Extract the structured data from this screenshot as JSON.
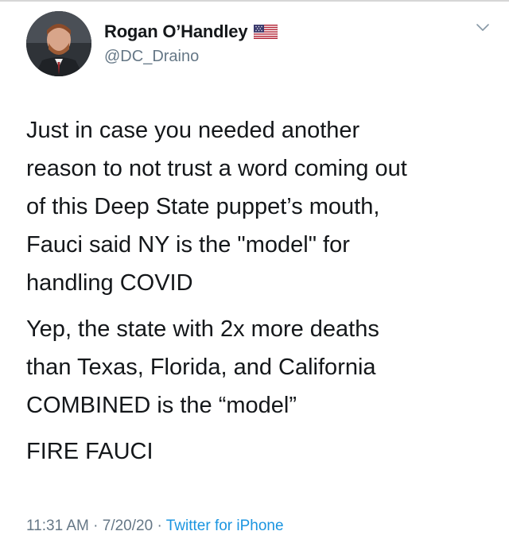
{
  "tweet": {
    "author": {
      "display_name": "Rogan O’Handley",
      "flag_icon": "us-flag-icon",
      "handle": "@DC_Draino"
    },
    "menu_icon": "chevron-down-icon",
    "paragraphs": [
      "Just in case you needed another\nreason to not trust a word coming out\nof this Deep State puppet’s mouth,\nFauci said NY is the \"model\" for\nhandling COVID",
      "Yep, the state with 2x more deaths\nthan Texas, Florida, and California\nCOMBINED is the “model”",
      "FIRE FAUCI"
    ],
    "meta": {
      "time": "11:31 AM",
      "separator": " · ",
      "date": "7/20/20",
      "source": "Twitter for iPhone"
    }
  },
  "colors": {
    "text": "#14171a",
    "secondary": "#657786",
    "link": "#1b95e0"
  }
}
